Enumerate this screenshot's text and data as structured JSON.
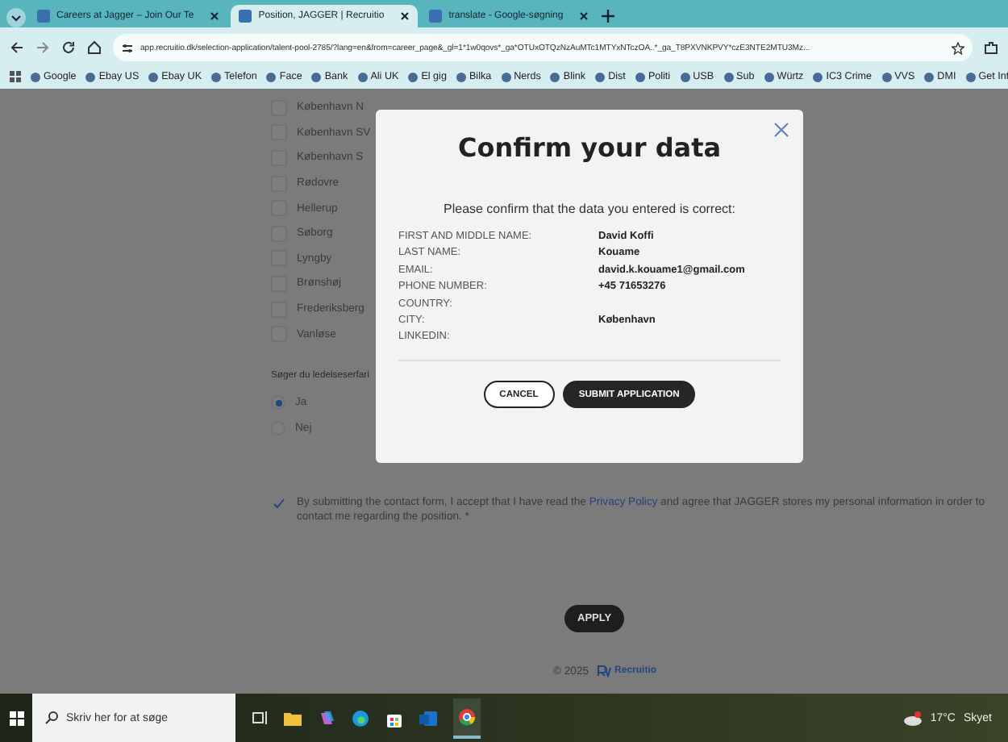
{
  "browser": {
    "tabs": [
      {
        "title": "Careers at Jagger – Join Our Te",
        "selected": false
      },
      {
        "title": "Position, JAGGER | Recruitio",
        "selected": true
      },
      {
        "title": "translate - Google-søgning",
        "selected": false
      }
    ],
    "url": "app.recruitio.dk/selection-application/talent-pool-2785/?lang=en&from=career_page&_gl=1*1w0qovs*_ga*OTUxOTQzNzAuMTc1MTYxNTczOA..*_ga_T8PXVNKPVY*czE3NTE2MTU3Mz...",
    "bookmarks": [
      "Google",
      "Ebay US",
      "Ebay UK",
      "Telefon",
      "Face",
      "Bank",
      "Ali UK",
      "El gig",
      "Bilka",
      "Nerds",
      "Blink",
      "Dist",
      "Politi",
      "USB",
      "Sub",
      "Würtz",
      "IC3 Crime",
      "VVS",
      "DMI",
      "Get Int"
    ]
  },
  "form": {
    "locations": [
      {
        "label": "København N",
        "checked": false
      },
      {
        "label": "København SV",
        "checked": false
      },
      {
        "label": "København S",
        "checked": false
      },
      {
        "label": "Rødovre",
        "checked": false
      },
      {
        "label": "Hellerup",
        "checked": false
      },
      {
        "label": "Søborg",
        "checked": false
      },
      {
        "label": "Lyngby",
        "checked": false
      },
      {
        "label": "Brønshøj",
        "checked": false
      },
      {
        "label": "Frederiksberg",
        "checked": false
      },
      {
        "label": "Vanløse",
        "checked": false
      }
    ],
    "question": "Søger du ledelseserfari",
    "answers": [
      {
        "label": "Ja",
        "selected": true
      },
      {
        "label": "Nej",
        "selected": false
      }
    ],
    "consent": {
      "checked": true,
      "before": "By submitting the contact form, I accept that I have read the",
      "link": "Privacy Policy",
      "after": "and agree that JAGGER stores my personal information in order to contact me regarding the position. *"
    },
    "apply_button": "APPLY",
    "footer": {
      "copyright": "© 2025",
      "brand": "Recruitio"
    }
  },
  "modal": {
    "title": "Confirm your data",
    "intro": "Please confirm that the data you entered is correct:",
    "fields": [
      {
        "label": "FIRST AND MIDDLE NAME:",
        "value": "David Koffi"
      },
      {
        "label": "LAST NAME:",
        "value": "Kouame"
      },
      {
        "label": "EMAIL:",
        "value": "david.k.kouame1@gmail.com"
      },
      {
        "label": "PHONE NUMBER:",
        "value": "+45 71653276"
      },
      {
        "label": "COUNTRY:"
      },
      {
        "label": "CITY:",
        "value": "København"
      },
      {
        "label": "LINKEDIN:"
      }
    ],
    "buttons": [
      {
        "label": "CANCEL",
        "kind": "secondary"
      },
      {
        "label": "SUBMIT APPLICATION",
        "kind": "primary"
      }
    ]
  },
  "taskbar": {
    "search_placeholder": "Skriv her for at søge",
    "temperature": "17°C",
    "condition": "Skyet"
  }
}
